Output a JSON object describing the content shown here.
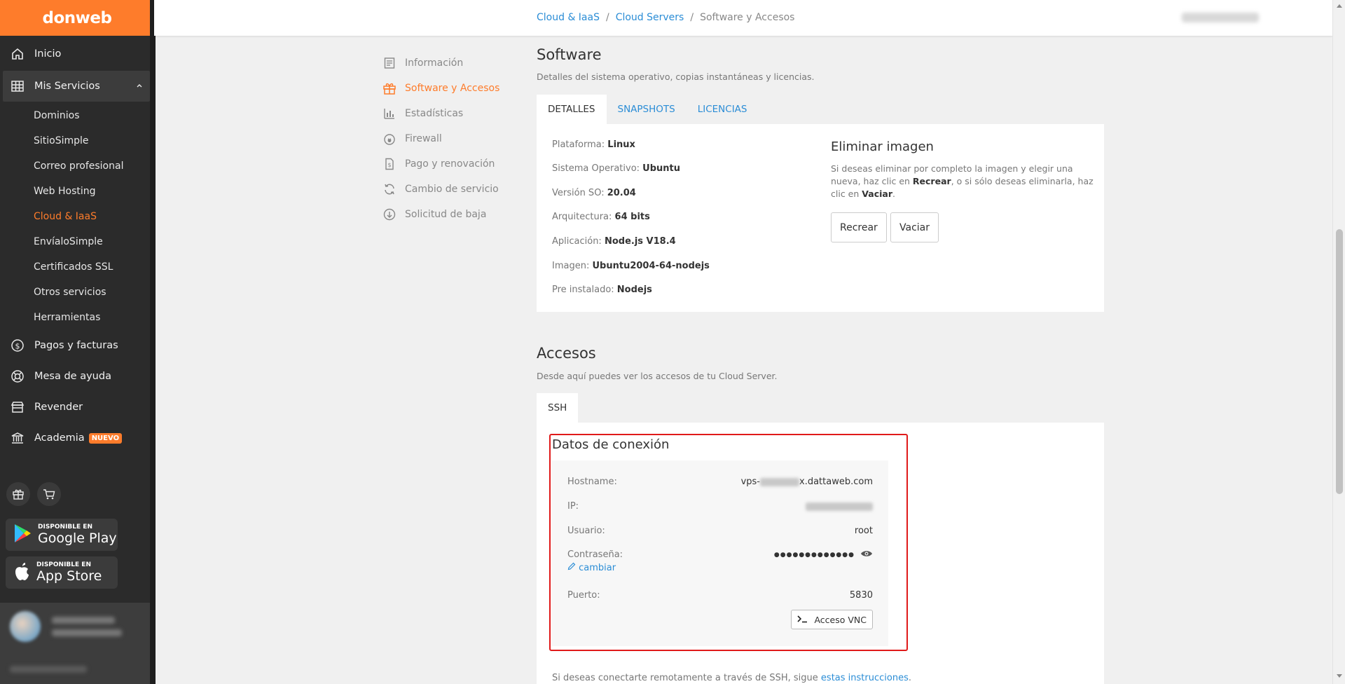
{
  "brand": {
    "logo": "donweb",
    "accent": "#fe7c2b",
    "link": "#2b8dd6",
    "highlight": "#e01a1a"
  },
  "nav": {
    "inicio": "Inicio",
    "mis_servicios": "Mis Servicios",
    "sub": [
      "Dominios",
      "SitioSimple",
      "Correo profesional",
      "Web Hosting",
      "Cloud & IaaS",
      "EnvíaloSimple",
      "Certificados SSL",
      "Otros servicios",
      "Herramientas"
    ],
    "pagos": "Pagos y facturas",
    "ayuda": "Mesa de ayuda",
    "revender": "Revender",
    "academia": "Academia",
    "nuevo": "NUEVO"
  },
  "stores": {
    "google_small": "DISPONIBLE EN",
    "google_big": "Google Play",
    "apple_small": "DISPONIBLE EN",
    "apple_big": "App Store"
  },
  "breadcrumb": {
    "b1": "Cloud & IaaS",
    "b2": "Cloud Servers",
    "b3": "Software y Accesos",
    "sep": "/"
  },
  "submenu": [
    "Información",
    "Software y Accesos",
    "Estadísticas",
    "Firewall",
    "Pago y renovación",
    "Cambio de servicio",
    "Solicitud de baja"
  ],
  "software": {
    "title": "Software",
    "subtitle": "Detalles del sistema operativo, copias instantáneas y licencias.",
    "tabs": [
      "DETALLES",
      "SNAPSHOTS",
      "LICENCIAS"
    ],
    "details": [
      {
        "label": "Plataforma:",
        "value": "Linux"
      },
      {
        "label": "Sistema Operativo:",
        "value": "Ubuntu"
      },
      {
        "label": "Versión SO:",
        "value": "20.04"
      },
      {
        "label": "Arquitectura:",
        "value": "64 bits"
      },
      {
        "label": "Aplicación:",
        "value": "Node.js V18.4"
      },
      {
        "label": "Imagen:",
        "value": "Ubuntu2004-64-nodejs"
      },
      {
        "label": "Pre instalado:",
        "value": "Nodejs"
      }
    ],
    "eliminar": {
      "title": "Eliminar imagen",
      "t1": "Si deseas eliminar por completo la imagen y elegir una nueva, haz clic en ",
      "b1": "Recrear",
      "t2": ", o si sólo deseas eliminarla, haz clic en ",
      "b2": "Vaciar",
      "t3": ".",
      "btn_recrear": "Recrear",
      "btn_vaciar": "Vaciar"
    }
  },
  "accesos": {
    "title": "Accesos",
    "subtitle": "Desde aquí puedes ver los accesos de tu Cloud Server.",
    "tab": "SSH",
    "conexion_title": "Datos de conexión",
    "hostname_label": "Hostname:",
    "hostname_prefix": "vps-",
    "hostname_suffix": "x.dattaweb.com",
    "ip_label": "IP:",
    "usuario_label": "Usuario:",
    "usuario_value": "root",
    "pass_label": "Contraseña:",
    "pass_value": "●●●●●●●●●●●●●",
    "cambiar": "cambiar",
    "puerto_label": "Puerto:",
    "puerto_value": "5830",
    "vnc": "Acceso VNC",
    "note_text": "Si deseas conectarte remotamente a través de SSH, sigue ",
    "note_link": "estas instrucciones",
    "note_end": "."
  }
}
